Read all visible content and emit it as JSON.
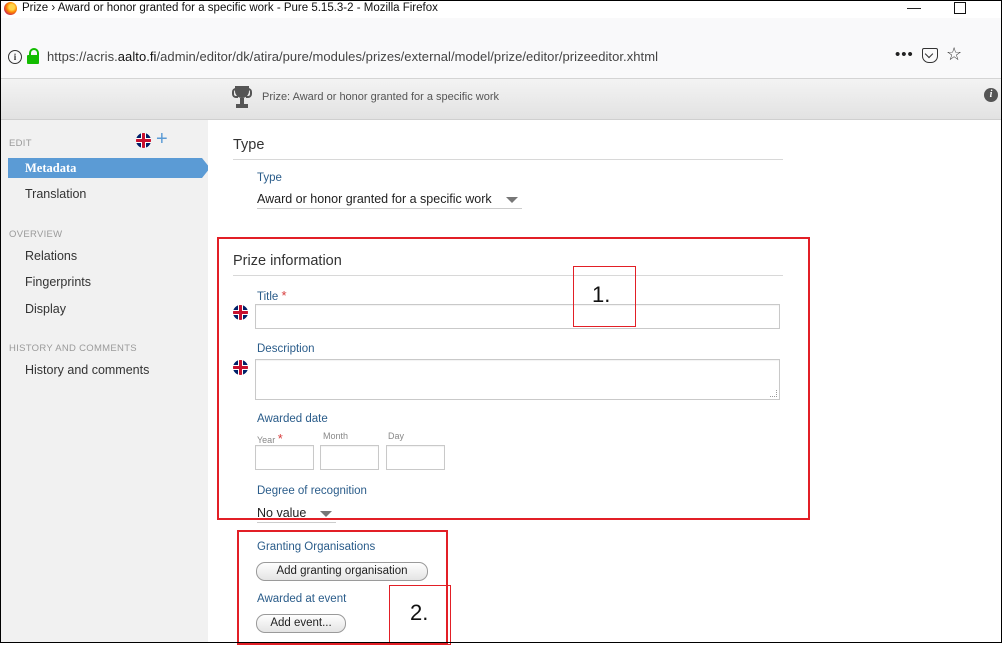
{
  "window": {
    "title": "Prize › Award or honor granted for a specific work - Pure 5.15.3-2 - Mozilla Firefox",
    "minimize": "—"
  },
  "browser": {
    "url_prefix": "https://acris.",
    "url_host": "aalto.fi",
    "url_path": "/admin/editor/dk/atira/pure/modules/prizes/external/model/prize/editor/prizeeditor.xhtml",
    "more": "•••",
    "star": "☆",
    "info": "i"
  },
  "appbar": {
    "title": "Prize: Award or honor granted for a specific work",
    "help": "i"
  },
  "sidebar": {
    "edit_header": "EDIT",
    "add": "+",
    "items_edit": [
      {
        "label": "Metadata",
        "active": true
      },
      {
        "label": "Translation"
      }
    ],
    "overview_header": "OVERVIEW",
    "items_overview": [
      {
        "label": "Relations"
      },
      {
        "label": "Fingerprints"
      },
      {
        "label": "Display"
      }
    ],
    "history_header": "HISTORY AND COMMENTS",
    "items_history": [
      {
        "label": "History and comments"
      }
    ]
  },
  "type_section": {
    "title": "Type",
    "field_label": "Type",
    "selected": "Award or honor granted for a specific work"
  },
  "prize_section": {
    "title": "Prize information",
    "title_label": "Title",
    "required_mark": "*",
    "description_label": "Description",
    "awarded_date_label": "Awarded date",
    "year_label": "Year",
    "month_label": "Month",
    "day_label": "Day",
    "degree_label": "Degree of recognition",
    "degree_value": "No value"
  },
  "granting": {
    "label": "Granting Organisations",
    "button": "Add granting organisation"
  },
  "event": {
    "label": "Awarded at event",
    "button": "Add event..."
  },
  "annotations": {
    "box1_label": "1.",
    "box2_label": "2.",
    "color": "#e21f26"
  }
}
